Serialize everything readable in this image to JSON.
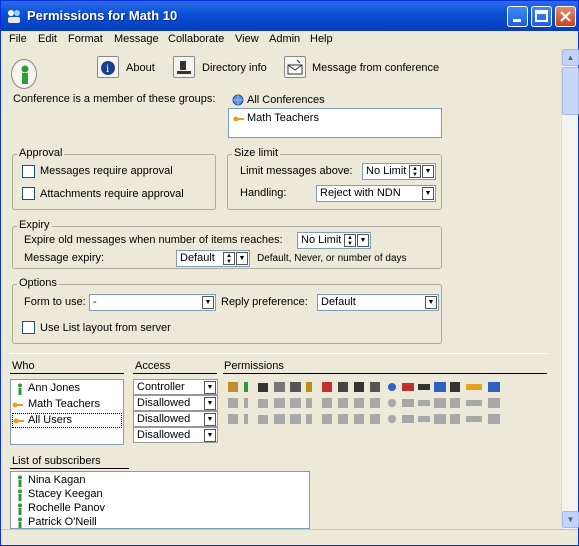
{
  "window": {
    "title": "Permissions for Math 10"
  },
  "menu": [
    "File",
    "Edit",
    "Format",
    "Message",
    "Collaborate",
    "View",
    "Admin",
    "Help"
  ],
  "toolbar": {
    "about": "About",
    "directory": "Directory info",
    "message": "Message from conference"
  },
  "groups": {
    "label": "Conference is a member of these groups:",
    "root": "All Conferences",
    "items": [
      "Math Teachers"
    ]
  },
  "approval": {
    "title": "Approval",
    "messages_require": "Messages require approval",
    "attachments_require": "Attachments require approval"
  },
  "size_limit": {
    "title": "Size limit",
    "limit_label": "Limit messages above:",
    "limit_value": "No Limit",
    "handling_label": "Handling:",
    "handling_value": "Reject with NDN"
  },
  "expiry": {
    "title": "Expiry",
    "expire_label": "Expire old messages when number of items reaches:",
    "expire_value": "No Limit",
    "message_expiry_label": "Message expiry:",
    "message_expiry_value": "Default",
    "hint": "Default, Never, or number of days"
  },
  "options": {
    "title": "Options",
    "form_label": "Form to use:",
    "form_value": "-",
    "reply_label": "Reply preference:",
    "reply_value": "Default",
    "list_layout": "Use List layout from server"
  },
  "table": {
    "who_header": "Who",
    "access_header": "Access",
    "permissions_header": "Permissions",
    "rows": [
      {
        "who": "Ann Jones",
        "access": "Controller"
      },
      {
        "who": "Math Teachers",
        "access": "Disallowed"
      },
      {
        "who": "All Users",
        "access": "Disallowed"
      },
      {
        "who": "",
        "access": "Disallowed"
      }
    ]
  },
  "subscribers": {
    "header": "List of subscribers",
    "items": [
      "Nina Kagan",
      "Stacey Keegan",
      "Rochelle Panov",
      "Patrick O'Neill"
    ]
  },
  "colors": {
    "title_blue": "#0A4FD6",
    "face": "#ECE9D8"
  }
}
